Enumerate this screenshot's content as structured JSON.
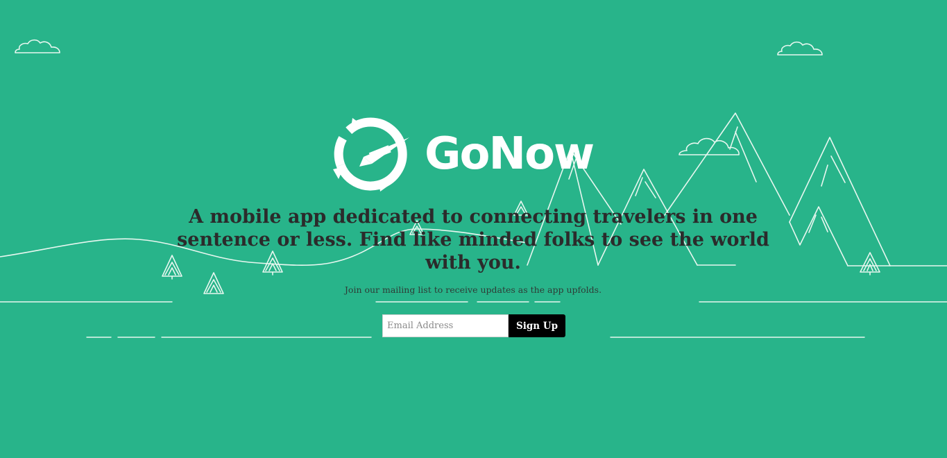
{
  "brand": {
    "name": "GoNow",
    "logo_icon": "compass-icon"
  },
  "hero": {
    "tagline": "A mobile app dedicated to connecting travelers in one sentence or less. Find like minded folks to see the world with you.",
    "subtext": "Join our mailing list to receive updates as the app upfolds."
  },
  "signup": {
    "email_placeholder": "Email Address",
    "button_label": "Sign Up"
  },
  "colors": {
    "background": "#28b48a",
    "line_art": "#ffffff",
    "text_dark": "#2b2b2b",
    "button_bg": "#000000"
  }
}
